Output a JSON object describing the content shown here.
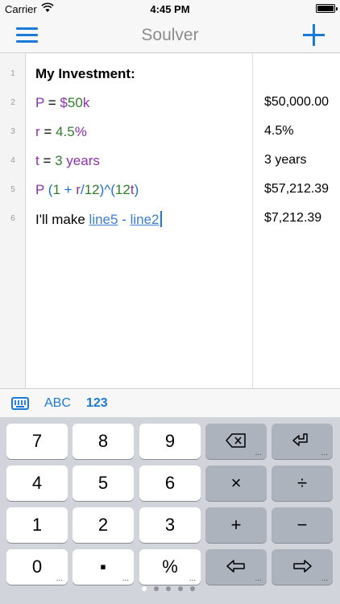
{
  "status_bar": {
    "carrier": "Carrier",
    "time": "4:45 PM",
    "wifi_icon": "wifi-icon",
    "battery_icon": "battery-icon"
  },
  "nav": {
    "title": "Soulver",
    "menu_icon": "hamburger-menu-icon",
    "add_icon": "plus-icon",
    "accent_color": "#1a7ad8"
  },
  "editor": {
    "lines": [
      {
        "number": "1",
        "answer": ""
      },
      {
        "number": "2",
        "answer": "$50,000.00"
      },
      {
        "number": "3",
        "answer": "4.5%"
      },
      {
        "number": "4",
        "answer": "3 years"
      },
      {
        "number": "5",
        "answer": "$57,212.39"
      },
      {
        "number": "6",
        "answer": "$7,212.39"
      }
    ],
    "line1": {
      "text": "My Investment:"
    },
    "line2": {
      "var": "P",
      "eq": " = ",
      "cur": "$",
      "num": "50",
      "suffix": "k"
    },
    "line3": {
      "var": "r",
      "eq": " = ",
      "num": "4.5",
      "pct": "%"
    },
    "line4": {
      "var": "t",
      "eq": " = ",
      "num": "3",
      "unit": " years"
    },
    "line5": {
      "p": "P",
      "open": " (",
      "one": "1",
      "plus": " + ",
      "r": "r",
      "div": "/",
      "twelve": "12",
      "close": ")^(",
      "twelve2": "12",
      "t": "t",
      "end": ")"
    },
    "line6": {
      "text": "I'll make ",
      "ref1": "line5",
      "minus": " - ",
      "ref2": "line2"
    },
    "colors": {
      "variable": "#8d2fb0",
      "number": "#2f7d2c",
      "operator": "#1c6fce",
      "reference": "#3b7ed0"
    }
  },
  "mode_bar": {
    "keyboard_icon": "keyboard-icon",
    "abc_label": "ABC",
    "num_label": "123"
  },
  "keypad": {
    "rows": [
      [
        "7",
        "8",
        "9",
        "backspace",
        "return"
      ],
      [
        "4",
        "5",
        "6",
        "×",
        "÷"
      ],
      [
        "1",
        "2",
        "3",
        "+",
        "−"
      ],
      [
        "0",
        "•",
        "%",
        "left",
        "right"
      ]
    ],
    "labels": {
      "k7": "7",
      "k8": "8",
      "k9": "9",
      "k4": "4",
      "k5": "5",
      "k6": "6",
      "k1": "1",
      "k2": "2",
      "k3": "3",
      "k0": "0",
      "kdot": "▪",
      "kpct": "%",
      "ktimes": "×",
      "kdivide": "÷",
      "kplus": "+",
      "kminus": "−",
      "more": "..."
    },
    "page_count": 5,
    "active_page": 1
  }
}
